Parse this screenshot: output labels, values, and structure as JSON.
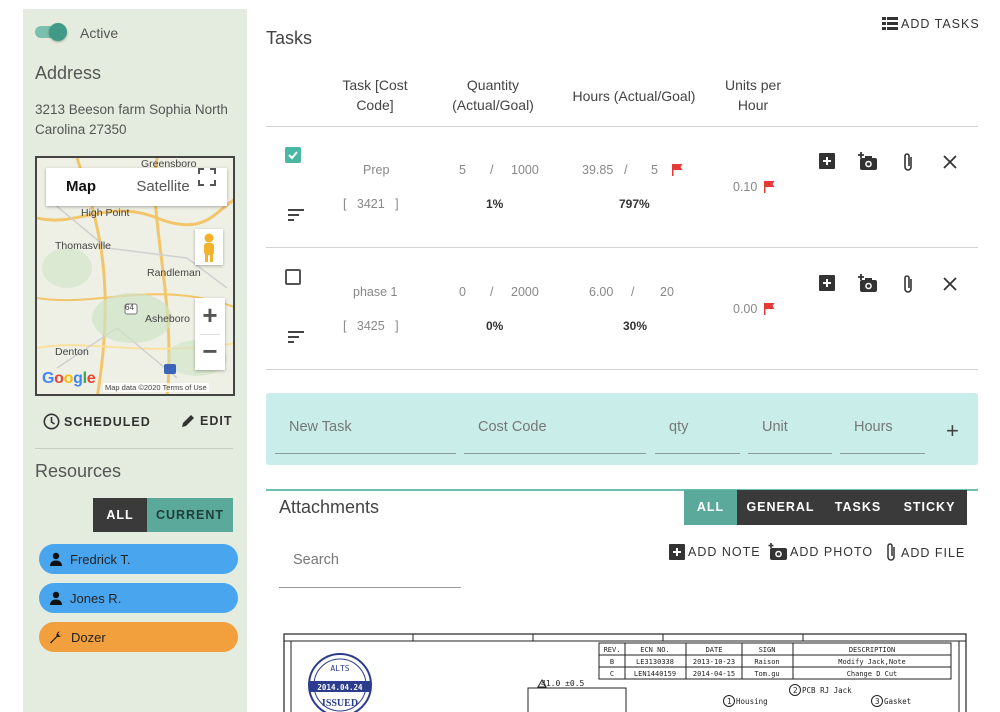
{
  "sidebar": {
    "active_label": "Active",
    "address_heading": "Address",
    "address_text": "3213 Beeson farm Sophia North Carolina 27350",
    "map": {
      "tab_map": "Map",
      "tab_satellite": "Satellite",
      "cities": [
        "Greensboro",
        "High Point",
        "Thomasville",
        "Randleman",
        "Asheboro",
        "Denton"
      ],
      "footer": "Map data ©2020",
      "terms": "Terms of Use",
      "google": "Google",
      "route_shields": [
        "64",
        "64",
        "73"
      ]
    },
    "scheduled_label": "SCHEDULED",
    "edit_label": "EDIT",
    "resources_heading": "Resources",
    "filter_all": "ALL",
    "filter_current": "CURRENT",
    "resources": [
      {
        "name": "Fredrick T.",
        "icon": "person-icon",
        "color": "#4aa5ef"
      },
      {
        "name": "Jones R.",
        "icon": "person-icon",
        "color": "#4aa5ef"
      },
      {
        "name": "Dozer",
        "icon": "wrench-icon",
        "color": "#f2a03d"
      }
    ]
  },
  "tasks": {
    "title": "Tasks",
    "add_tasks_label": "ADD TASKS",
    "headers": {
      "task": "Task [Cost Code]",
      "quantity": "Quantity (Actual/Goal)",
      "hours": "Hours (Actual/Goal)",
      "units": "Units per Hour"
    },
    "rows": [
      {
        "checked": true,
        "name": "Prep",
        "cost_code": "3421",
        "qty_actual": "5",
        "qty_goal": "1000",
        "qty_pct": "1%",
        "hours_actual": "39.85",
        "hours_goal": "5",
        "hours_pct": "797%",
        "units_per_hour": "0.10",
        "hours_flag": true,
        "units_flag": true
      },
      {
        "checked": false,
        "name": "phase 1",
        "cost_code": "3425",
        "qty_actual": "0",
        "qty_goal": "2000",
        "qty_pct": "0%",
        "hours_actual": "6.00",
        "hours_goal": "20",
        "hours_pct": "30%",
        "units_per_hour": "0.00",
        "hours_flag": false,
        "units_flag": true
      }
    ],
    "new_task": {
      "name_placeholder": "New Task",
      "cost_code_placeholder": "Cost Code",
      "qty_placeholder": "qty",
      "unit_placeholder": "Unit",
      "hours_placeholder": "Hours",
      "add_symbol": "+"
    }
  },
  "attachments": {
    "title": "Attachments",
    "filters": [
      {
        "label": "ALL",
        "color": "#5aa99a"
      },
      {
        "label": "GENERAL",
        "color": "#3a3a3a"
      },
      {
        "label": "TASKS",
        "color": "#3a3a3a"
      },
      {
        "label": "STICKY",
        "color": "#3a3a3a"
      }
    ],
    "search_placeholder": "Search",
    "add_note": "ADD NOTE",
    "add_photo": "ADD PHOTO",
    "add_file": "ADD FILE",
    "drawing": {
      "rev_headers": [
        "REV.",
        "ECN NO.",
        "DATE",
        "SIGN",
        "DESCRIPTION"
      ],
      "rev_rows": [
        [
          "B",
          "LE3130338",
          "2013-10-23",
          "Raison",
          "Modify Jack,Note"
        ],
        [
          "C",
          "LEN1440159",
          "2014-04-15",
          "Tom.gu",
          "Change D Cut"
        ]
      ],
      "stamp_top": "ALTS",
      "stamp_date": "2014.04.24",
      "stamp_status": "ISSUED",
      "dimension": "41.0 ±0.5",
      "callouts": [
        "1 Housing",
        "2 PCB RJ Jack",
        "3 Gasket"
      ]
    }
  },
  "colors": {
    "sidebar_bg": "#e4ecdf",
    "accent_teal": "#5aa99a",
    "new_task_bg": "#c9ede8",
    "flag_red": "#e53935",
    "dark_button": "#3a3a3a"
  }
}
